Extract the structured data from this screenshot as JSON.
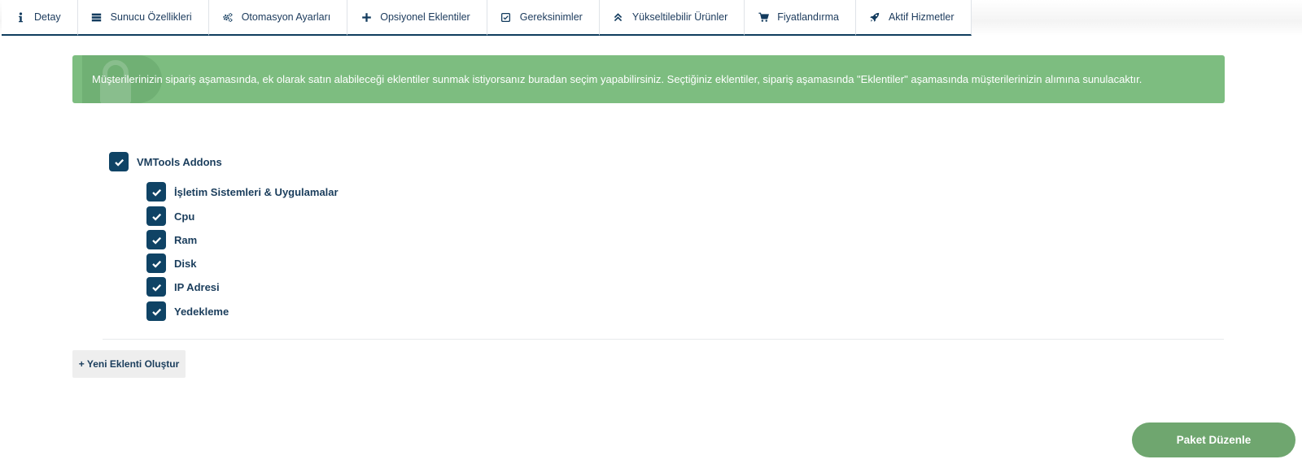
{
  "tabs": [
    {
      "label": "Detay",
      "icon": "info-icon"
    },
    {
      "label": "Sunucu Özellikleri",
      "icon": "server-icon"
    },
    {
      "label": "Otomasyon Ayarları",
      "icon": "gears-icon"
    },
    {
      "label": "Opsiyonel Eklentiler",
      "icon": "plus-icon",
      "active": true
    },
    {
      "label": "Gereksinimler",
      "icon": "check-square-icon"
    },
    {
      "label": "Yükseltilebilir Ürünler",
      "icon": "chevron-double-up-icon"
    },
    {
      "label": "Fiyatlandırma",
      "icon": "cart-icon"
    },
    {
      "label": "Aktif Hizmetler",
      "icon": "rocket-icon"
    }
  ],
  "alert": {
    "text": "Müşterilerinizin sipariş aşamasında, ek olarak satın alabileceği eklentiler sunmak istiyorsanız buradan seçim yapabilirsiniz. Seçtiğiniz eklentiler, sipariş aşamasında \"Eklentiler\" aşamasında müşterilerinizin alımına sunulacaktır.",
    "color": "#7dbd80"
  },
  "addons": {
    "group_label": "VMTools Addons",
    "group_checked": true,
    "items": [
      {
        "label": "İşletim Sistemleri & Uygulamalar",
        "checked": true
      },
      {
        "label": "Cpu",
        "checked": true
      },
      {
        "label": "Ram",
        "checked": true
      },
      {
        "label": "Disk",
        "checked": true
      },
      {
        "label": "IP Adresi",
        "checked": true
      },
      {
        "label": "Yedekleme",
        "checked": true
      }
    ]
  },
  "actions": {
    "new_addon_label": "+ Yeni Eklenti Oluştur",
    "save_label": "Paket Düzenle"
  },
  "colors": {
    "checkbox": "#0f4365",
    "save_button": "#6fa66f",
    "text": "#1a3d5c"
  }
}
